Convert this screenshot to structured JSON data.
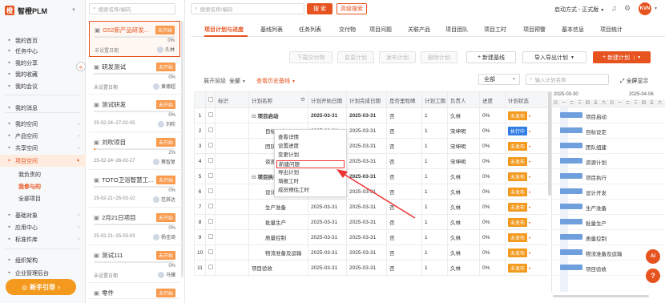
{
  "brand": {
    "name": "智橙PLM"
  },
  "sidebar": {
    "items": [
      {
        "label": "我的首页",
        "icon": "home-icon"
      },
      {
        "label": "任务中心",
        "icon": "task-icon"
      },
      {
        "label": "我的分享",
        "icon": "share-icon"
      },
      {
        "label": "我的收藏",
        "icon": "star-icon"
      },
      {
        "label": "我的会议",
        "icon": "meeting-icon"
      },
      {
        "label": "我的消息",
        "icon": "message-icon"
      },
      {
        "label": "我的空间",
        "icon": "folder-icon"
      },
      {
        "label": "产品空间",
        "icon": "cube-icon"
      },
      {
        "label": "共享空间",
        "icon": "share-folder-icon"
      },
      {
        "label": "项目空间",
        "icon": "project-icon"
      },
      {
        "label": "我负责的"
      },
      {
        "label": "我参与的"
      },
      {
        "label": "全部项目"
      },
      {
        "label": "基础对象",
        "icon": "object-icon"
      },
      {
        "label": "应用中心",
        "icon": "apps-icon"
      },
      {
        "label": "标准件库",
        "icon": "library-icon"
      },
      {
        "label": "组织架构",
        "icon": "org-icon"
      },
      {
        "label": "企业管理后台",
        "icon": "admin-icon"
      }
    ],
    "guide_button": "新手引导"
  },
  "project_list": {
    "search_placeholder": "搜索名称/编码",
    "cards": [
      {
        "name": "G52新产品研发...",
        "tag": "未开始",
        "progress": 0,
        "pct": "0%",
        "date": "未设置日期",
        "owner": "久林"
      },
      {
        "name": "研发测试",
        "tag": "未开始",
        "progress": 0,
        "pct": "0%",
        "date": "未设置日期",
        "owner": "黄德超"
      },
      {
        "name": "测试研发",
        "tag": "未开始",
        "progress": 0,
        "pct": "0%",
        "date": "25-02-24~27-02-05",
        "owner": "刘吹"
      },
      {
        "name": "刘吹项目",
        "tag": "未开始",
        "progress": 2,
        "pct": "2%",
        "date": "25-02-24~26-02-27",
        "owner": "蔡智复"
      },
      {
        "name": "TOTO卫浴智慧工...",
        "tag": "未开始",
        "progress": 0,
        "pct": "0%",
        "date": "25-02-21~25-03-10",
        "owner": "范其达"
      },
      {
        "name": "2月21日项目",
        "tag": "未开始",
        "progress": 0,
        "pct": "0%",
        "date": "25-02-21~25-03-03",
        "owner": "杨佳琦"
      },
      {
        "name": "测试111",
        "tag": "未开始",
        "progress": 0,
        "pct": "0%",
        "date": "未设置日期",
        "owner": "马骥"
      },
      {
        "name": "零件",
        "tag": "未开始"
      }
    ]
  },
  "topbar": {
    "search_placeholder": "搜索名称/编码",
    "search_button": "搜 索",
    "advanced_button": "高级搜索",
    "start_mode": "启动方式 - 正式版",
    "avatar": "KVN"
  },
  "tabs": [
    "项目计划与进度",
    "基线列表",
    "任务列表",
    "交付物",
    "项目问题",
    "关联产品",
    "项目团队",
    "项目工时",
    "项目预警",
    "基本信息",
    "项目统计"
  ],
  "toolbar": {
    "buttons": [
      "下载交付物",
      "变更计划",
      "发布计划",
      "删除计划"
    ],
    "new_baseline": "新建基线",
    "import_export": "导入导出计划",
    "new_plan": "新建计划"
  },
  "filter": {
    "expand_label": "展开层级",
    "expand_value": "全部",
    "history": "查看历史基线",
    "scope": "全部",
    "search_placeholder": "输入计划名称",
    "fullscreen": "全屏显示"
  },
  "table": {
    "headers": [
      "标识",
      "计划名称",
      "计划开始日期",
      "计划完成日期",
      "是否里程碑",
      "计划工期",
      "负责人",
      "进度",
      "计划状态"
    ],
    "rows": [
      {
        "no": "1",
        "name": "项目启动",
        "group": true,
        "start": "2025-03-31",
        "end": "2025-03-31",
        "ms": "否",
        "dur": "1",
        "owner": "久林",
        "pct": "0%",
        "status": "未发布",
        "run": false
      },
      {
        "no": "2",
        "name": "目标设定",
        "start": "2025-03-31",
        "end": "2025-03-31",
        "ms": "否",
        "dur": "1",
        "owner": "宋坤明",
        "pct": "0%",
        "status": "执行中",
        "run": true
      },
      {
        "no": "3",
        "name": "团队组建",
        "start": "2025-03-31",
        "end": "2025-03-31",
        "ms": "否",
        "dur": "1",
        "owner": "宋坤明",
        "pct": "0%",
        "status": "未发布",
        "run": false
      },
      {
        "no": "4",
        "name": "资源计划",
        "start": "2025-03-31",
        "end": "2025-03-31",
        "ms": "否",
        "dur": "1",
        "owner": "宋坤明",
        "pct": "0%",
        "status": "未发布",
        "run": false
      },
      {
        "no": "5",
        "name": "项目执行",
        "group": true,
        "start": "2025-03-31",
        "end": "2025-03-31",
        "ms": "否",
        "dur": "1",
        "owner": "久林",
        "pct": "0%",
        "status": "未发布",
        "run": false
      },
      {
        "no": "6",
        "name": "设计开发",
        "start": "2025-03-31",
        "end": "2025-03-31",
        "ms": "否",
        "dur": "1",
        "owner": "久林",
        "pct": "0%",
        "status": "未发布",
        "run": false
      },
      {
        "no": "7",
        "name": "生产准备",
        "start": "2025-03-31",
        "end": "2025-03-31",
        "ms": "否",
        "dur": "1",
        "owner": "久林",
        "pct": "0%",
        "status": "未发布",
        "run": false
      },
      {
        "no": "8",
        "name": "批量生产",
        "start": "2025-03-31",
        "end": "2025-03-31",
        "ms": "否",
        "dur": "1",
        "owner": "久林",
        "pct": "0%",
        "status": "未发布",
        "run": false
      },
      {
        "no": "9",
        "name": "质量控制",
        "start": "2025-03-31",
        "end": "2025-03-31",
        "ms": "否",
        "dur": "1",
        "owner": "久林",
        "pct": "0%",
        "status": "未发布",
        "run": false
      },
      {
        "no": "10",
        "name": "物流准备及运输",
        "start": "2025-03-31",
        "end": "2025-03-31",
        "ms": "否",
        "dur": "1",
        "owner": "久林",
        "pct": "0%",
        "status": "未发布",
        "run": false
      },
      {
        "no": "11",
        "name": "项目验收",
        "start": "2025-03-31",
        "end": "2025-03-31",
        "ms": "否",
        "dur": "1",
        "owner": "久林",
        "pct": "0%",
        "status": "未发布",
        "run": false
      }
    ]
  },
  "gantt": {
    "weeks": [
      "2025-03-30",
      "2025-04-06"
    ],
    "days": [
      "日",
      "一",
      "二",
      "三",
      "四",
      "五",
      "六",
      "日",
      "一",
      "二",
      "三",
      "四",
      "五",
      "六"
    ],
    "labels": [
      "项目启动",
      "目标设定",
      "团队组建",
      "资源计划",
      "项目执行",
      "设计开发",
      "生产准备",
      "批量生产",
      "质量控制",
      "物流准备及运输",
      "项目验收"
    ]
  },
  "context_menu": [
    "查看详情",
    "设置进度",
    "变更计划",
    "新建问题",
    "导出计划",
    "填报工时",
    "成员预估工时"
  ],
  "colors": {
    "accent": "#e6531f",
    "tag": "#f39a1e",
    "running": "#2f7ce6",
    "gantt_bar": "#6f9fdc"
  }
}
